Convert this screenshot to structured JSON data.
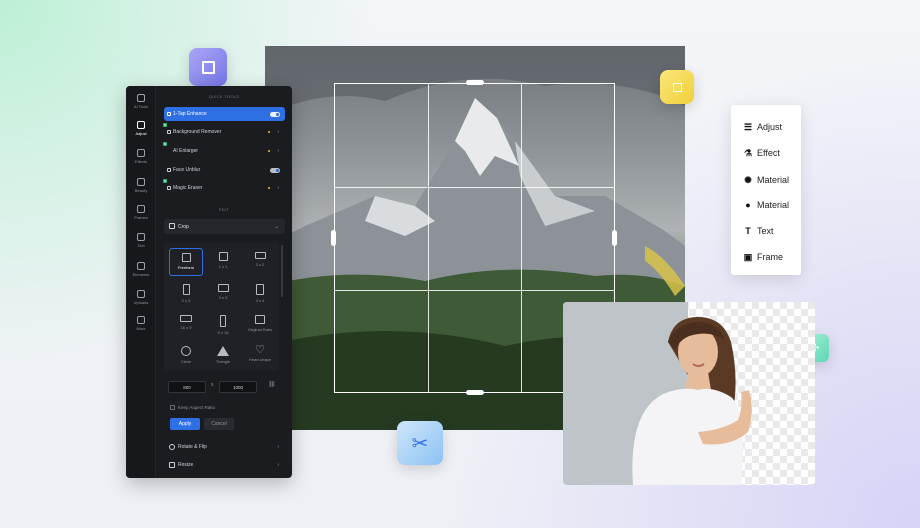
{
  "editor": {
    "rail": [
      {
        "label": "AI Tools",
        "icon": "ai-tools-icon"
      },
      {
        "label": "Adjust",
        "icon": "adjust-icon",
        "active": true
      },
      {
        "label": "Effects",
        "icon": "effects-icon"
      },
      {
        "label": "Beauty",
        "icon": "beauty-icon"
      },
      {
        "label": "Frames",
        "icon": "frames-icon"
      },
      {
        "label": "Text",
        "icon": "text-icon"
      },
      {
        "label": "Elements",
        "icon": "elements-icon"
      },
      {
        "label": "Uploads",
        "icon": "uploads-icon"
      },
      {
        "label": "More",
        "icon": "more-icon"
      }
    ],
    "section_tools": "QUICK TOOLS",
    "tools": [
      {
        "label": "1-Tap Enhance",
        "active": true,
        "toggle": true
      },
      {
        "label": "Background Remover",
        "new": true
      },
      {
        "label": "AI Enlarger",
        "new": true
      },
      {
        "label": "Face Unblur",
        "toggle": true
      },
      {
        "label": "Magic Eraser",
        "new": true
      }
    ],
    "section_edit": "EDIT",
    "dropdown_label": "Crop",
    "ratios": [
      {
        "label": "Freeform",
        "selected": true
      },
      {
        "label": "1 x 1"
      },
      {
        "label": "3 x 2"
      },
      {
        "label": "2 x 3"
      },
      {
        "label": "4 x 3"
      },
      {
        "label": "3 x 4"
      },
      {
        "label": "16 x 9"
      },
      {
        "label": "9 x 16"
      },
      {
        "label": "Original Ratio"
      },
      {
        "label": "Circle"
      },
      {
        "label": "Triangle"
      },
      {
        "label": "Heart-shape"
      }
    ],
    "width_value": "800",
    "height_value": "1000",
    "times_symbol": "x",
    "keep_aspect_label": "Keep Aspect Ratio",
    "apply_label": "Apply",
    "cancel_label": "Cancel",
    "rotate_label": "Rotate & Flip",
    "resize_label": "Resize"
  },
  "menu": [
    {
      "label": "Adjust",
      "icon": "sliders-icon",
      "glyph": "☰"
    },
    {
      "label": "Effect",
      "icon": "flask-icon",
      "glyph": "⚗"
    },
    {
      "label": "Material",
      "icon": "sparkle-icon",
      "glyph": "✺"
    },
    {
      "label": "Material",
      "icon": "circle-icon",
      "glyph": "●"
    },
    {
      "label": "Text",
      "icon": "text-t-icon",
      "glyph": "T"
    },
    {
      "label": "Frame",
      "icon": "frame-icon",
      "glyph": "▣"
    }
  ],
  "colors": {
    "accent": "#2f6fe4",
    "panel_bg": "#1b1c20",
    "crop_tile": "#8f8ef0",
    "yellow_tile": "#f2d545",
    "scissors_tile": "#5aa9f0",
    "checker_tile": "#6fe0c0"
  }
}
